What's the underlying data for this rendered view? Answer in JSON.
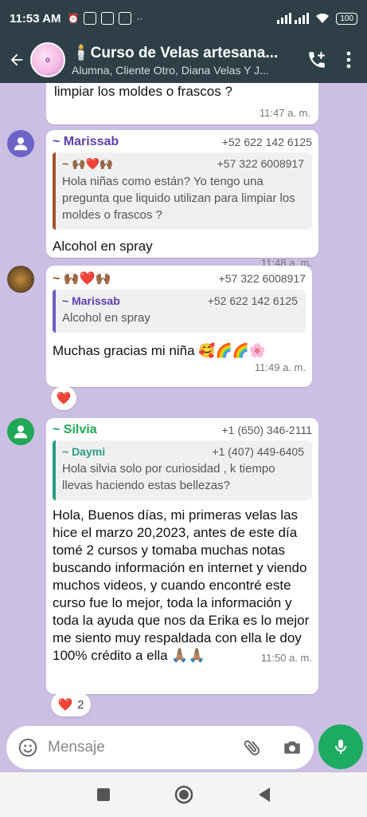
{
  "status_bar": {
    "time": "11:53 AM",
    "battery": "100"
  },
  "header": {
    "title": "🕯️Curso de Velas artesana...",
    "subtitle": "Alumna, Cliente Otro, Diana Velas Y J..."
  },
  "messages": [
    {
      "text_tail": "limpiar los moldes o frascos ?",
      "time": "11:47 a. m."
    },
    {
      "sender": "~ Marissab",
      "phone": "+52 622 142 6125",
      "quote": {
        "name": "~ 🙌🏾❤️🙌🏾",
        "phone": "+57 322 6008917",
        "text": "Hola niñas como están? Yo tengo una pregunta que liquido utilizan para limpiar los moldes o frascos ?"
      },
      "text": "Alcohol en spray",
      "time": "11:48 a. m."
    },
    {
      "sender": "~ 🙌🏾❤️🙌🏾",
      "phone": "+57 322 6008917",
      "quote": {
        "name": "~ Marissab",
        "phone": "+52 622 142 6125",
        "text": "Alcohol en spray"
      },
      "text": "Muchas gracias mi niña 🥰🌈🌈🌸",
      "time": "11:49 a. m.",
      "reaction": {
        "emoji": "❤️"
      }
    },
    {
      "sender": "~ Silvia",
      "phone": "+1 (650) 346-2111",
      "quote": {
        "name": "~ Daymi",
        "phone": "+1 (407) 449-6405",
        "text": "Hola silvia solo por curiosidad , k tiempo llevas haciendo estas bellezas?"
      },
      "text": "Hola, Buenos días, mi primeras velas las hice el marzo 20,2023, antes de este día tomé 2 cursos y tomaba muchas notas buscando información en internet y viendo muchos videos, y cuando encontré este curso fue lo mejor, toda la información y toda la ayuda que nos da Erika es lo mejor me siento muy respaldada con ella le doy 100% crédito a ella 🙏🏽🙏🏽",
      "time": "11:50 a. m.",
      "reaction": {
        "emoji": "❤️",
        "count": "2"
      }
    }
  ],
  "input": {
    "placeholder": "Mensaje"
  },
  "colors": {
    "header_bg": "#2e3f47",
    "chat_bg": "#cbbfe3",
    "accent_green": "#1daa61",
    "sender_marissab": "#5b3fa8",
    "sender_silvia": "#1fa855",
    "sender_emoji": "#8a4a2c"
  },
  "icons": [
    "back-arrow-icon",
    "add-call-icon",
    "more-vert-icon",
    "emoji-icon",
    "attach-icon",
    "camera-icon",
    "mic-icon",
    "nav-square-icon",
    "nav-circle-icon",
    "nav-back-icon"
  ]
}
